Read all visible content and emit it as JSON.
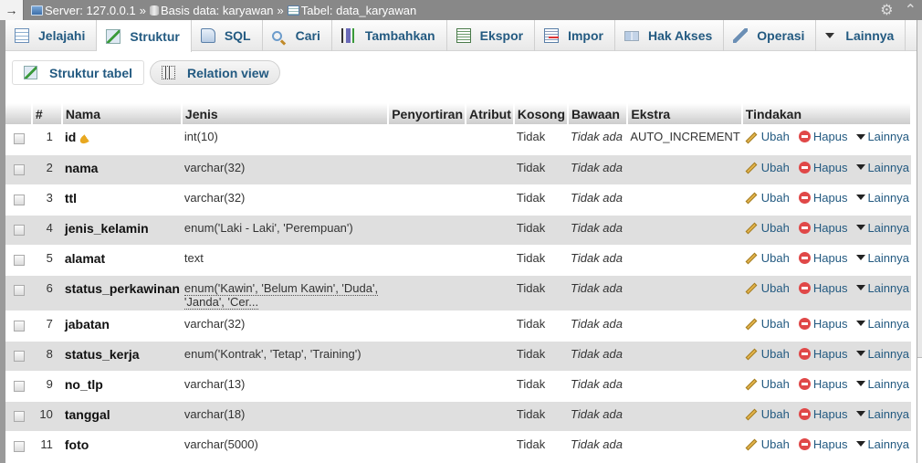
{
  "breadcrumb": {
    "back_arrow": "→",
    "server": "Server: 127.0.0.1",
    "database": "Basis data: karyawan",
    "table": "Tabel: data_karyawan",
    "separator": "»"
  },
  "top_icons": {
    "settings": "⚙",
    "collapse": "⌃"
  },
  "tabs": [
    {
      "label": "Jelajahi",
      "icon": "browse-icon",
      "active": false
    },
    {
      "label": "Struktur",
      "icon": "structure-icon",
      "active": true
    },
    {
      "label": "SQL",
      "icon": "sql-icon",
      "active": false
    },
    {
      "label": "Cari",
      "icon": "search-icon",
      "active": false
    },
    {
      "label": "Tambahkan",
      "icon": "insert-icon",
      "active": false
    },
    {
      "label": "Ekspor",
      "icon": "export-icon",
      "active": false
    },
    {
      "label": "Impor",
      "icon": "import-icon",
      "active": false
    },
    {
      "label": "Hak Akses",
      "icon": "privileges-icon",
      "active": false
    },
    {
      "label": "Operasi",
      "icon": "wrench-icon",
      "active": false
    },
    {
      "label": "Lainnya",
      "icon": "triangle-down-icon",
      "active": false
    }
  ],
  "subbuttons": {
    "structure_table": "Struktur tabel",
    "relation_view": "Relation view"
  },
  "table": {
    "headers": [
      "#",
      "Nama",
      "Jenis",
      "Penyortiran",
      "Atribut",
      "Kosong",
      "Bawaan",
      "Ekstra",
      "Tindakan"
    ],
    "actions": {
      "edit": "Ubah",
      "delete": "Hapus",
      "more": "Lainnya"
    },
    "rows": [
      {
        "num": "1",
        "name": "id",
        "primary_key": true,
        "type": "int(10)",
        "collation": "",
        "attributes": "",
        "null": "Tidak",
        "default": "Tidak ada",
        "extra": "AUTO_INCREMENT"
      },
      {
        "num": "2",
        "name": "nama",
        "type": "varchar(32)",
        "collation": "",
        "attributes": "",
        "null": "Tidak",
        "default": "Tidak ada",
        "extra": ""
      },
      {
        "num": "3",
        "name": "ttl",
        "type": "varchar(32)",
        "collation": "",
        "attributes": "",
        "null": "Tidak",
        "default": "Tidak ada",
        "extra": ""
      },
      {
        "num": "4",
        "name": "jenis_kelamin",
        "type": "enum('Laki - Laki', 'Perempuan')",
        "collation": "",
        "attributes": "",
        "null": "Tidak",
        "default": "Tidak ada",
        "extra": ""
      },
      {
        "num": "5",
        "name": "alamat",
        "type": "text",
        "collation": "",
        "attributes": "",
        "null": "Tidak",
        "default": "Tidak ada",
        "extra": ""
      },
      {
        "num": "6",
        "name": "status_perkawinan",
        "type_line1": "enum('Kawin', 'Belum Kawin', 'Duda',",
        "type_line2": "'Janda', 'Cer...",
        "collation": "",
        "attributes": "",
        "null": "Tidak",
        "default": "Tidak ada",
        "extra": ""
      },
      {
        "num": "7",
        "name": "jabatan",
        "type": "varchar(32)",
        "collation": "",
        "attributes": "",
        "null": "Tidak",
        "default": "Tidak ada",
        "extra": ""
      },
      {
        "num": "8",
        "name": "status_kerja",
        "type": "enum('Kontrak', 'Tetap', 'Training')",
        "collation": "",
        "attributes": "",
        "null": "Tidak",
        "default": "Tidak ada",
        "extra": ""
      },
      {
        "num": "9",
        "name": "no_tlp",
        "type": "varchar(13)",
        "collation": "",
        "attributes": "",
        "null": "Tidak",
        "default": "Tidak ada",
        "extra": ""
      },
      {
        "num": "10",
        "name": "tanggal",
        "type": "varchar(18)",
        "collation": "",
        "attributes": "",
        "null": "Tidak",
        "default": "Tidak ada",
        "extra": ""
      },
      {
        "num": "11",
        "name": "foto",
        "type": "varchar(5000)",
        "collation": "",
        "attributes": "",
        "null": "Tidak",
        "default": "Tidak ada",
        "extra": ""
      }
    ]
  },
  "colors": {
    "topbar": "#888888",
    "link": "#235a81",
    "row_alt": "#dfdfdf"
  }
}
